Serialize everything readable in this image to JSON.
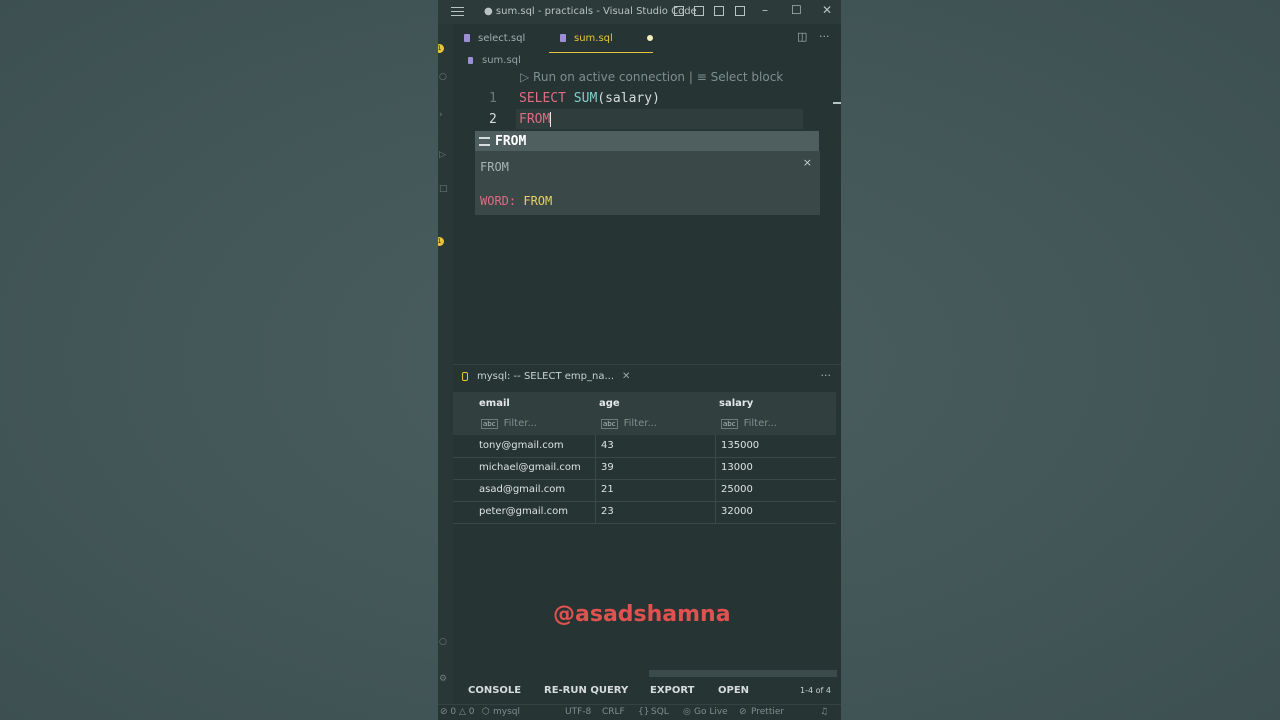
{
  "window": {
    "title": "● sum.sql - practicals - Visual Studio Code"
  },
  "tabs": [
    {
      "label": "select.sql"
    },
    {
      "label": "sum.sql"
    }
  ],
  "breadcrumb": {
    "file": "sum.sql"
  },
  "editor": {
    "codelens": "▷ Run on active connection | ≡ Select block",
    "line_numbers": [
      "1",
      "2"
    ],
    "line1": {
      "kw": "SELECT",
      "fn": "SUM",
      "open": "(",
      "arg": "salary",
      "close": ")"
    },
    "line2": {
      "text": "FROM"
    }
  },
  "suggest": {
    "item_label": "FROM",
    "details_title": "FROM",
    "doc_key": "WORD:",
    "doc_value": "FROM",
    "close_glyph": "×"
  },
  "results": {
    "tab_label": "mysql: -- SELECT emp_na...",
    "tab_close": "✕",
    "more": "···",
    "columns": [
      "email",
      "age",
      "salary"
    ],
    "filter_placeholder": "Filter...",
    "rows": [
      [
        "tony@gmail.com",
        "43",
        "135000"
      ],
      [
        "michael@gmail.com",
        "39",
        "13000"
      ],
      [
        "asad@gmail.com",
        "21",
        "25000"
      ],
      [
        "peter@gmail.com",
        "23",
        "32000"
      ]
    ],
    "buttons": {
      "console": "CONSOLE",
      "rerun": "RE-RUN QUERY",
      "export": "EXPORT",
      "open": "OPEN"
    },
    "count": "1-4 of 4"
  },
  "statusbar": {
    "problems": "⊘ 0 △ 0",
    "connection": "mysql",
    "encoding": "UTF-8",
    "eol": "CRLF",
    "language": "SQL",
    "golive": "Go Live",
    "prettier": "Prettier"
  },
  "watermark": "@asadshamna",
  "colors": {
    "accent": "#e8c43e",
    "keyword": "#e06c84",
    "function": "#7fd0c8",
    "watermark": "#e0524f"
  }
}
